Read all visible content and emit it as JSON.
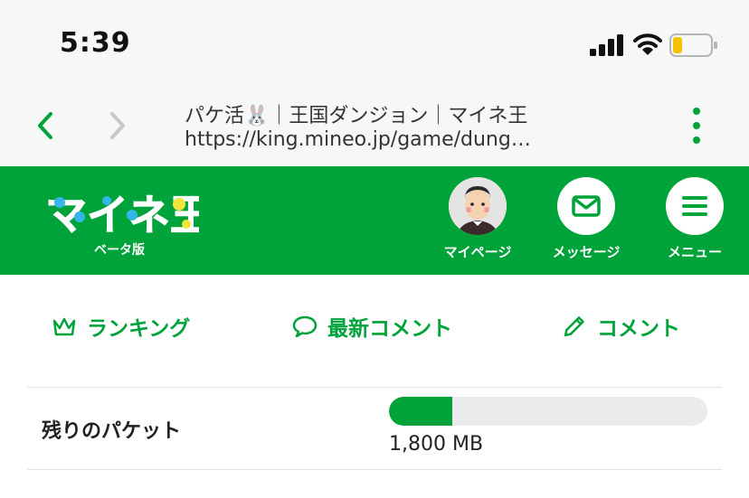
{
  "status_bar": {
    "time": "5:39",
    "battery_level": 0.25,
    "battery_color": "#f5c400"
  },
  "browser": {
    "title": "パケ活🐰｜王国ダンジョン｜マイネ王",
    "url": "https://king.mineo.jp/game/dung…"
  },
  "header": {
    "logo_text": "マイネ王",
    "logo_sub": "ベータ版",
    "items": [
      {
        "label": "マイページ",
        "icon": "avatar-icon"
      },
      {
        "label": "メッセージ",
        "icon": "envelope-icon"
      },
      {
        "label": "メニュー",
        "icon": "hamburger-icon"
      }
    ],
    "brand_color": "#00a23a"
  },
  "tabs": [
    {
      "label": "ランキング",
      "icon": "crown-icon"
    },
    {
      "label": "最新コメント",
      "icon": "speech-bubble-icon"
    },
    {
      "label": "コメント",
      "icon": "pencil-icon"
    }
  ],
  "packet": {
    "label": "残りのパケット",
    "amount": "1,800 MB",
    "fill_fraction": 0.2
  }
}
